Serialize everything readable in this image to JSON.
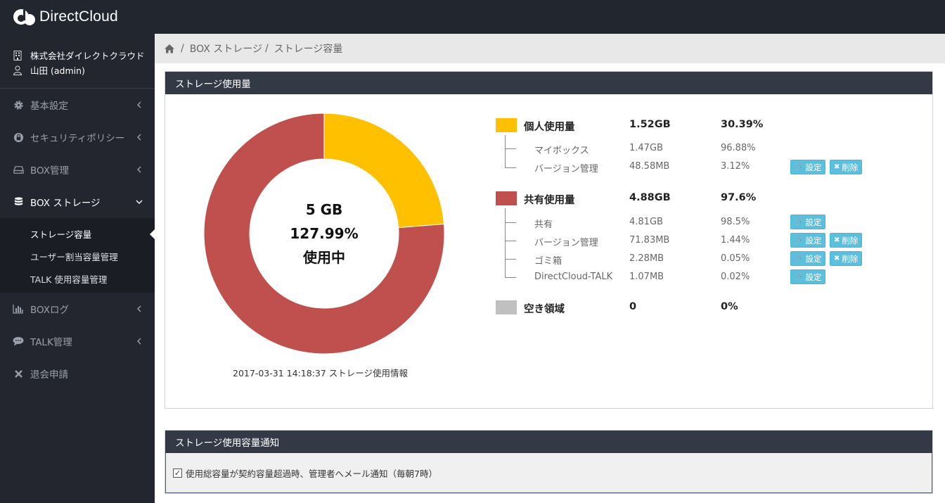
{
  "app": {
    "brand": "DirectCloud"
  },
  "sidebar": {
    "company": "株式会社ダイレクトクラウド",
    "user": "山田 (admin)",
    "items": [
      {
        "label": "基本設定",
        "icon": "gear-icon"
      },
      {
        "label": "セキュリティポリシー",
        "icon": "lock-icon"
      },
      {
        "label": "BOX管理",
        "icon": "drive-icon"
      },
      {
        "label": "BOX ストレージ",
        "icon": "database-icon"
      },
      {
        "label": "BOXログ",
        "icon": "bar-chart-icon"
      },
      {
        "label": "TALK管理",
        "icon": "chat-icon"
      },
      {
        "label": "退会申請",
        "icon": "close-icon"
      }
    ],
    "submenu": [
      "ストレージ容量",
      "ユーザー割当容量管理",
      "TALK 使用容量管理"
    ]
  },
  "breadcrumb": {
    "items": [
      "BOX ストレージ",
      "ストレージ容量"
    ]
  },
  "usage_panel": {
    "title": "ストレージ使用量",
    "center": {
      "total": "5 GB",
      "percent": "127.99%",
      "status": "使用中"
    },
    "timestamp": "2017-03-31 14:18:37 ストレージ使用情報",
    "groups": {
      "personal": {
        "label": "個人使用量",
        "size": "1.52GB",
        "percent": "30.39%",
        "color": "#f8c000"
      },
      "shared": {
        "label": "共有使用量",
        "size": "4.88GB",
        "percent": "97.6%",
        "color": "#c0504d"
      },
      "free": {
        "label": "空き領域",
        "size": "0",
        "percent": "0%",
        "color": "#c0c0c0"
      }
    },
    "personal_rows": [
      {
        "label": "マイボックス",
        "size": "1.47GB",
        "percent": "96.88%"
      },
      {
        "label": "バージョン管理",
        "size": "48.58MB",
        "percent": "3.12%"
      }
    ],
    "shared_rows": [
      {
        "label": "共有",
        "size": "4.81GB",
        "percent": "98.5%"
      },
      {
        "label": "バージョン管理",
        "size": "71.83MB",
        "percent": "1.44%"
      },
      {
        "label": "ゴミ箱",
        "size": "2.28MB",
        "percent": "0.05%"
      },
      {
        "label": "DirectCloud-TALK",
        "size": "1.07MB",
        "percent": "0.02%"
      }
    ],
    "buttons": {
      "settings": "設定",
      "delete": "削除"
    }
  },
  "chart_data": {
    "type": "pie",
    "series": [
      {
        "name": "個人使用量",
        "value": 30.39,
        "color": "#ffc000"
      },
      {
        "name": "共有使用量",
        "value": 97.6,
        "color": "#c0504d"
      },
      {
        "name": "空き領域",
        "value": 0,
        "color": "#c0c0c0"
      }
    ],
    "donut": true
  },
  "notify_panel": {
    "title": "ストレージ使用容量通知",
    "checkbox_label": "使用総容量が契約容量超過時、管理者へメール通知（毎朝7時）",
    "checked": true
  }
}
